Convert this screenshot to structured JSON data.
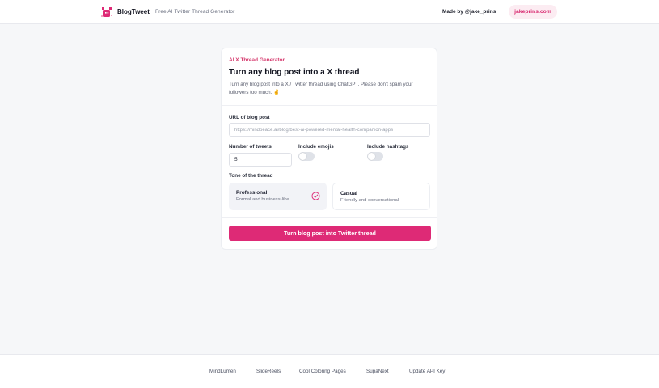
{
  "header": {
    "brand": "BlogTweet",
    "tagline": "Free AI Twitter Thread Generator",
    "made_by": "Made by @jake_prins",
    "site_link": "jakeprins.com",
    "accent_color": "#de2a76"
  },
  "card": {
    "eyebrow": "AI X Thread Generator",
    "title": "Turn any blog post into a X thread",
    "description": "Turn any blog post into a X / Twitter thread using ChatGPT. Please don't spam your followers too much. ✌️",
    "url_label": "URL of blog post",
    "url_placeholder": "https://mindpeace.ai/blog/best-ai-powered-mental-health-companion-apps",
    "tweets_label": "Number of tweets",
    "tweets_value": "5",
    "emojis_label": "Include emojis",
    "emojis_on": false,
    "hashtags_label": "Include hashtags",
    "hashtags_on": false,
    "tone_label": "Tone of the thread",
    "tones": [
      {
        "title": "Professional",
        "subtitle": "Formal and business-like",
        "selected": true
      },
      {
        "title": "Casual",
        "subtitle": "Friendly and conversational",
        "selected": false
      }
    ],
    "submit_label": "Turn blog post into Twitter thread"
  },
  "footer": {
    "links": [
      "MindLumen",
      "SlideReels",
      "Cool Coloring Pages",
      "SupaNext",
      "Update API Key"
    ]
  }
}
